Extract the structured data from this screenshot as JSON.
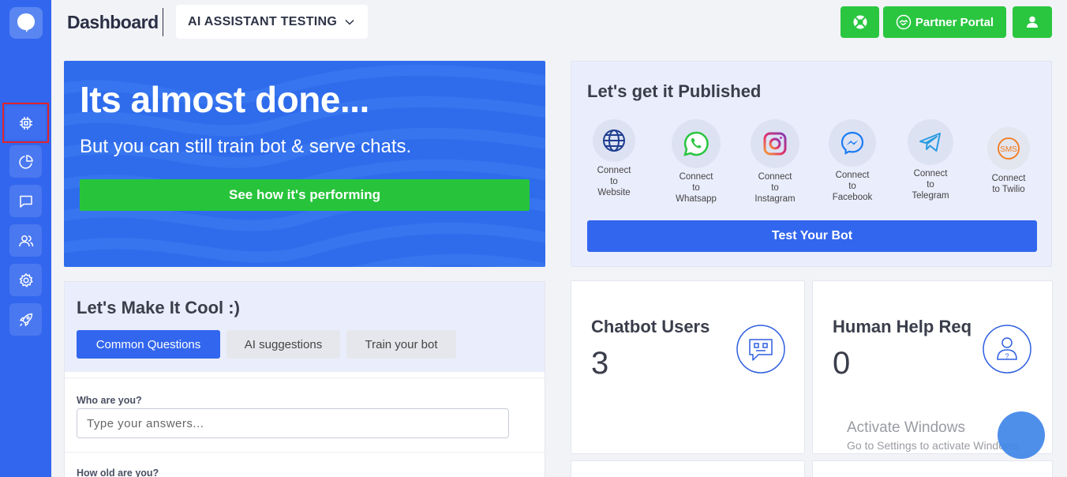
{
  "header": {
    "title": "Dashboard",
    "project": "AI ASSISTANT TESTING",
    "partner_label": "Partner Portal"
  },
  "sidebar": {
    "items": [
      {
        "icon": "chip-icon",
        "selected": true
      },
      {
        "icon": "pie-chart-icon"
      },
      {
        "icon": "chat-icon"
      },
      {
        "icon": "users-icon"
      },
      {
        "icon": "gear-icon"
      },
      {
        "icon": "rocket-icon"
      }
    ]
  },
  "hero": {
    "title": "Its almost done...",
    "subtitle": "But you can still train bot & serve chats.",
    "button": "See how it's performing"
  },
  "publish": {
    "title": "Let's get it Published",
    "channels": [
      {
        "label1": "Connect",
        "label2": "to",
        "label3": "Website",
        "icon": "globe-icon"
      },
      {
        "label1": "Connect",
        "label2": "to",
        "label3": "Whatsapp",
        "icon": "whatsapp-icon"
      },
      {
        "label1": "Connect",
        "label2": "to",
        "label3": "Instagram",
        "icon": "instagram-icon"
      },
      {
        "label1": "Connect",
        "label2": "to",
        "label3": "Facebook",
        "icon": "messenger-icon"
      },
      {
        "label1": "Connect",
        "label2": "to",
        "label3": "Telegram",
        "icon": "telegram-icon"
      },
      {
        "label1": "Connect",
        "label2": "to Twilio",
        "label3": "",
        "icon": "sms-icon"
      }
    ],
    "test_button": "Test Your Bot"
  },
  "cool": {
    "title": "Let's Make It Cool :)",
    "tabs": [
      "Common Questions",
      "AI suggestions",
      "Train your bot"
    ],
    "questions": [
      {
        "label": "Who are you?",
        "placeholder": "Type your answers..."
      },
      {
        "label": "How old are you?"
      }
    ]
  },
  "stats": [
    {
      "title": "Chatbot Users",
      "value": "3"
    },
    {
      "title": "Human Help Req",
      "value": "0"
    }
  ],
  "watermark": {
    "line1": "Activate Windows",
    "line2": "Go to Settings to activate Windows."
  },
  "colors": {
    "primary": "#3266ee",
    "success": "#2ac640",
    "panel": "#eaedfb"
  }
}
